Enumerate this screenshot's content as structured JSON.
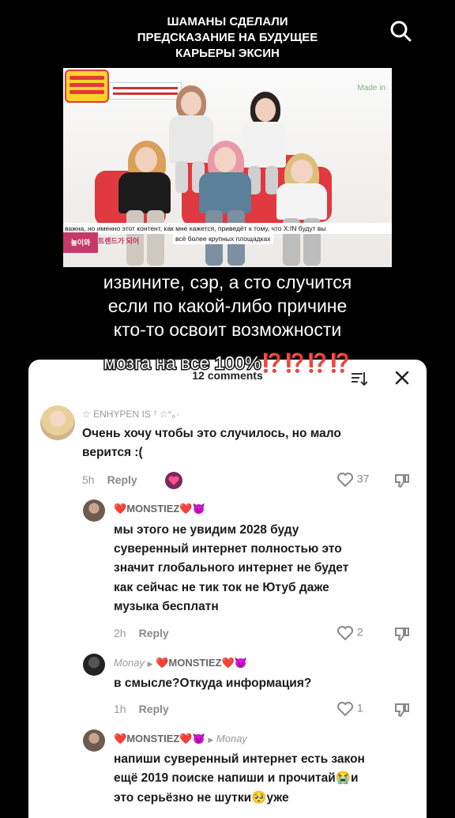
{
  "header": {
    "title_lines": [
      "ШАМАНЫ СДЕЛАЛИ",
      "ПРЕДСКАЗАНИЕ НА БУДУЩЕЕ",
      "КАРЬЕРЫ ЭКСИН"
    ]
  },
  "video": {
    "watermark": "Made in",
    "subtitle_line1": "важна, но именно этот контент, как мне кажется, приведёт к тому, что X:IN будут вы",
    "subtitle_line2": "всё более крупных площадках",
    "show_logo": "놀이와",
    "show_text": "트렌드가 되어"
  },
  "caption": {
    "line1": "извините, сэр, а сто случится",
    "line2": "если по какой-либо причине",
    "line3": "кто-то освоит возможности",
    "line4_text": "мозга на все 100%",
    "line4_marks": "⁉️⁉️⁉️⁉️"
  },
  "comments_panel": {
    "count_label": "12 comments",
    "comments": [
      {
        "username": "☆ ENHYPEN IS ⁷ ☆°。·",
        "text_lines": [
          "Очень хочу чтобы это случилось, но мало",
          "верится :("
        ],
        "time": "5h",
        "reply_label": "Reply",
        "likes": "37"
      },
      {
        "username_prefix": "❤️",
        "username": "MONSTIEZ",
        "username_suffix": "❤️😈",
        "text_lines": [
          "мы этого не увидим 2028 буду",
          "суверенный интернет полностью это",
          "значит глобального интернет не будет",
          "как сейчас не тик ток не Ютуб даже",
          "музыка бесплатн"
        ],
        "time": "2h",
        "reply_label": "Reply",
        "likes": "2"
      },
      {
        "username": "Monay",
        "reply_to_prefix": "❤️",
        "reply_to": "MONSTIEZ",
        "reply_to_suffix": "❤️😈",
        "text_lines": [
          "в смысле?Откуда информация?"
        ],
        "time": "1h",
        "reply_label": "Reply",
        "likes": "1"
      },
      {
        "username_prefix": "❤️",
        "username": "MONSTIEZ",
        "username_suffix": "❤️😈",
        "reply_to": "Monay",
        "text_lines": [
          "напиши суверенный интернет есть закон",
          "ещё 2019 поиске напиши и прочитай😭и",
          "это серьёзно не шутки🥺уже"
        ]
      }
    ]
  },
  "colors": {
    "accent_red": "#e51c44",
    "caption_mark": "#ff2222"
  }
}
